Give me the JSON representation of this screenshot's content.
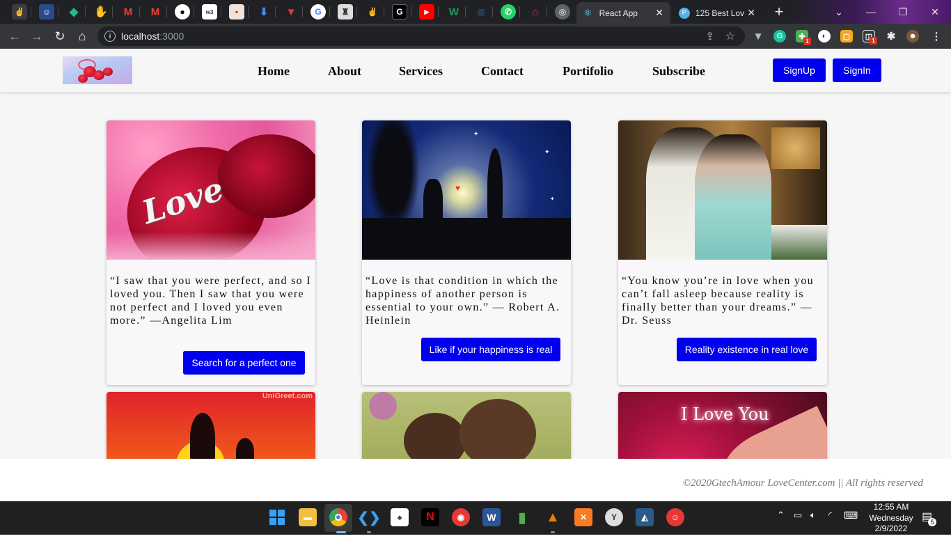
{
  "browser": {
    "tabs": [
      {
        "title": "React App",
        "favicon": "react-icon"
      },
      {
        "title": "125 Best Lov",
        "favicon": "p-icon"
      }
    ],
    "url_host": "localhost",
    "url_port": ":3000",
    "ext_badges": [
      "1",
      "1"
    ]
  },
  "site": {
    "logo_alt": "roses logo",
    "nav": [
      "Home",
      "About",
      "Services",
      "Contact",
      "Portifolio",
      "Subscribe"
    ],
    "signup_label": "SignUp",
    "signin_label": "SignIn",
    "cards": [
      {
        "quote": "“I saw that you were perfect, and so I loved you. Then I saw that you were not perfect and I loved you even more.” —Angelita Lim",
        "button": "Search for a perfect one"
      },
      {
        "quote": "“Love is that condition in which the happiness of another person is essential to your own.” — Robert A. Heinlein",
        "button": "Like if your happiness is real"
      },
      {
        "quote": "“You know you’re in love when you can’t fall asleep because reality is finally better than your dreams.” —Dr. Seuss",
        "button": "Reality existence in real love"
      }
    ],
    "image_text": {
      "card4_watermark": "UniGreet.com",
      "card6_text": "I Love You",
      "card1_text": "Love"
    },
    "footer": "©2020GtechAmour LoveCenter.com || All rights reserved"
  },
  "taskbar": {
    "time": "12:55 AM",
    "day": "Wednesday",
    "date": "2/9/2022",
    "notifications": "5"
  },
  "colors": {
    "accent": "#0000ee",
    "page_bg": "#f7f6f7"
  }
}
